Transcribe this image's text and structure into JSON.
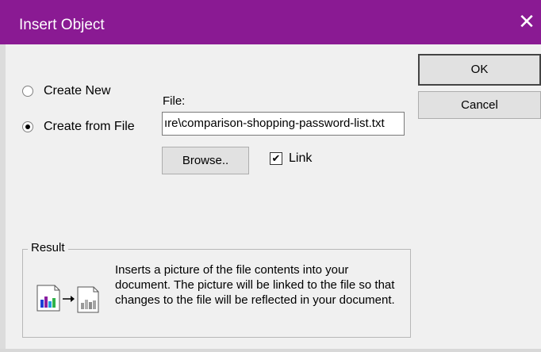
{
  "window": {
    "title": "Insert Object",
    "close_icon": "close-icon",
    "colors": {
      "titlebar": "#8a1a93",
      "background": "#f0f0f0"
    }
  },
  "options": {
    "create_new": {
      "label": "Create New",
      "selected": false
    },
    "create_from_file": {
      "label": "Create from File",
      "selected": true
    }
  },
  "file": {
    "label": "File:",
    "value": "ıre\\comparison-shopping-password-list.txt"
  },
  "buttons": {
    "ok": "OK",
    "cancel": "Cancel",
    "browse": "Browse.."
  },
  "link": {
    "label": "Link",
    "checked": true,
    "check_mark": "✔"
  },
  "result": {
    "legend": "Result",
    "text": "Inserts a picture of the file contents into your document.  The picture will be linked to the file so that changes to the file will be reflected in your document.",
    "icon": "linked-file-picture-icon"
  }
}
